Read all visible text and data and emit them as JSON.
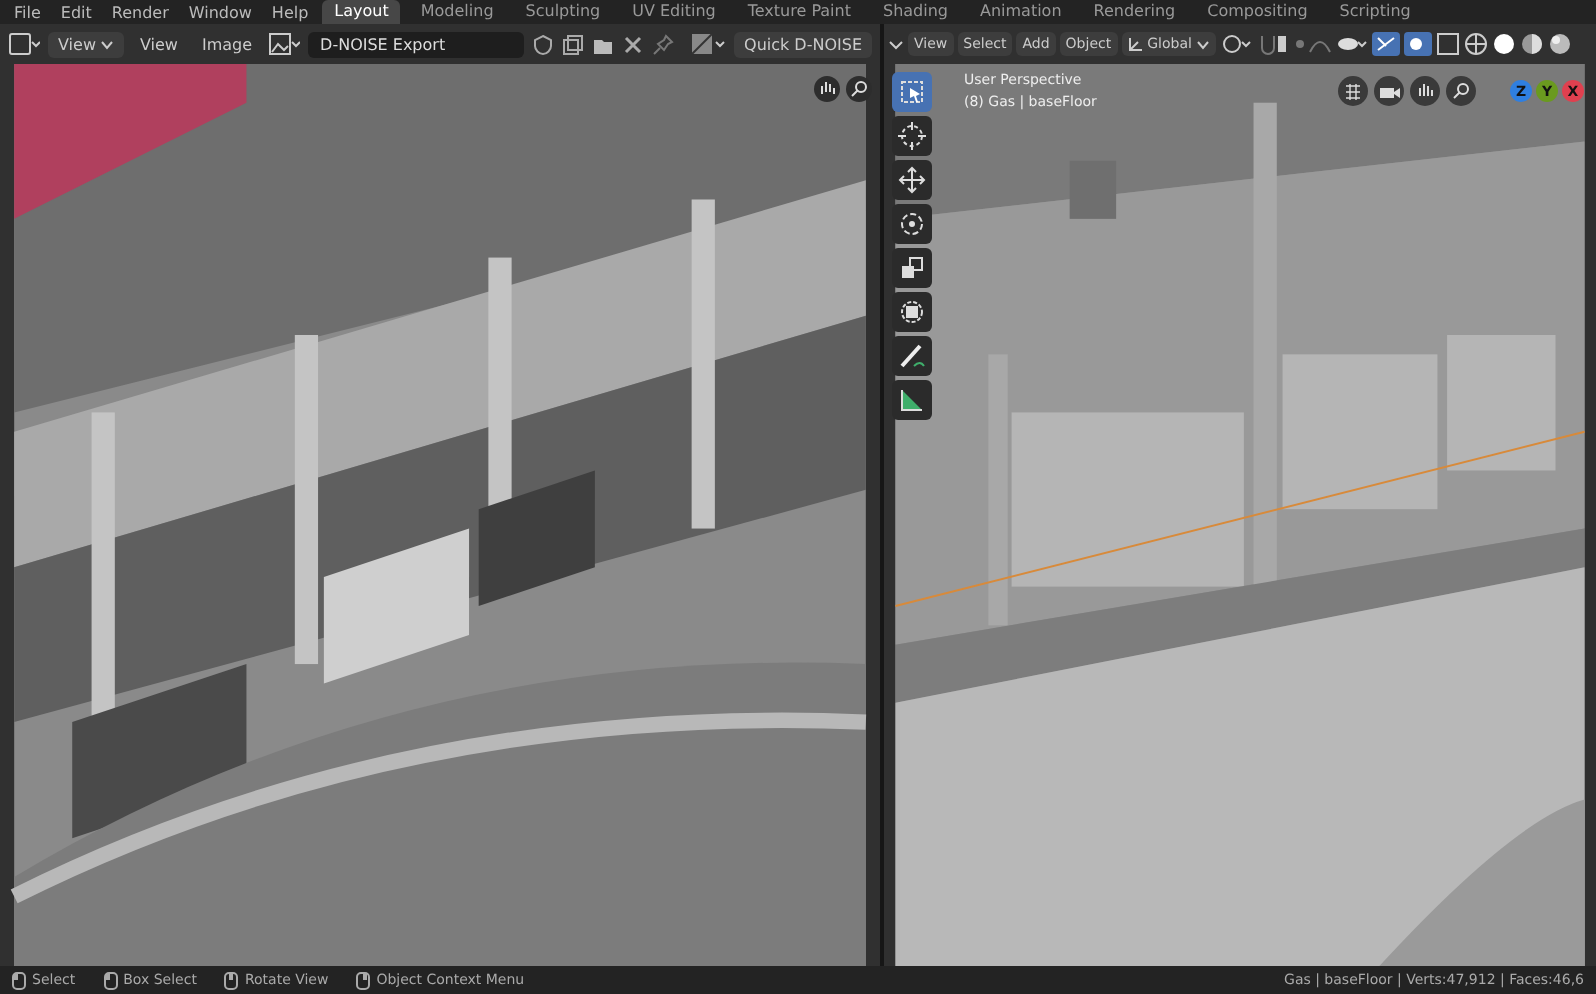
{
  "topbar": {
    "menus": [
      "File",
      "Edit",
      "Render",
      "Window",
      "Help"
    ],
    "workspaces": [
      {
        "label": "Layout",
        "selected": true
      },
      {
        "label": "Modeling",
        "selected": false
      },
      {
        "label": "Sculpting",
        "selected": false
      },
      {
        "label": "UV Editing",
        "selected": false
      },
      {
        "label": "Texture Paint",
        "selected": false
      },
      {
        "label": "Shading",
        "selected": false
      },
      {
        "label": "Animation",
        "selected": false
      },
      {
        "label": "Rendering",
        "selected": false
      },
      {
        "label": "Compositing",
        "selected": false
      },
      {
        "label": "Scripting",
        "selected": false
      }
    ]
  },
  "image_editor": {
    "header": {
      "view_mode": "View",
      "menus": [
        "View",
        "Image"
      ],
      "image_name": "D-NOISE Export",
      "button": "Quick D-NOISE"
    }
  },
  "viewport": {
    "header": {
      "menus": [
        "View",
        "Select",
        "Add",
        "Object"
      ],
      "orientation": "Global"
    },
    "overlay": [
      "User Perspective",
      "(8) Gas | baseFloor"
    ],
    "tools": [
      {
        "kind": "select",
        "selected": true
      },
      {
        "kind": "cursor",
        "selected": false
      },
      {
        "kind": "move",
        "selected": false
      },
      {
        "kind": "rotate",
        "selected": false
      },
      {
        "kind": "scale",
        "selected": false
      },
      {
        "kind": "transform",
        "selected": false
      },
      {
        "kind": "annotate",
        "selected": false
      },
      {
        "kind": "measure",
        "selected": false
      }
    ],
    "gizmo": [
      {
        "label": "Z",
        "color": "#2f7fe0"
      },
      {
        "label": "Y",
        "color": "#6a9a1f"
      },
      {
        "label": "X",
        "color": "#e0404f"
      }
    ]
  },
  "status_bar": {
    "hints": [
      "Select",
      "Box Select",
      "Rotate View",
      "Object Context Menu"
    ],
    "stats": "Gas | baseFloor | Verts:47,912 | Faces:46,6"
  }
}
